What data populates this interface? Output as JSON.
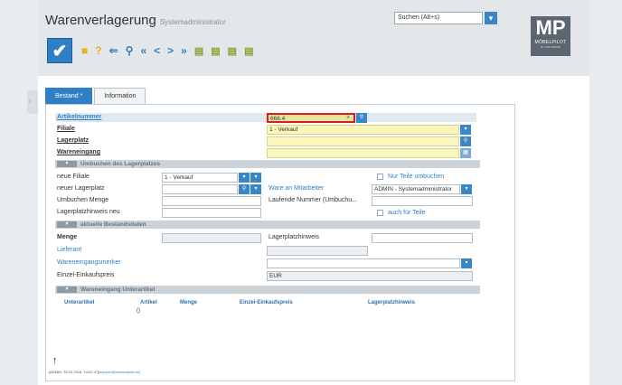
{
  "header": {
    "title": "Warenverlagerung",
    "subtitle": "Systemadministrator",
    "search_placeholder": "Suchen (Alt+s)"
  },
  "logo": {
    "mp": "MP",
    "brand": "MÖBELPILOT",
    "tagline": "BY SOFTWARE"
  },
  "toolbar": {
    "icons": [
      "check-icon",
      "save-icon",
      "help-icon",
      "back-icon",
      "search-icon",
      "first-icon",
      "prev-icon",
      "next-icon",
      "last-icon",
      "db-icon",
      "db-add-icon",
      "db-edit-icon",
      "db-delete-icon"
    ],
    "glyphs": {
      "check": "✔",
      "help": "?",
      "back": "⇐",
      "search": "🔍",
      "first": "«",
      "prev": "<",
      "next": ">",
      "last": "»"
    }
  },
  "tabs": [
    {
      "label": "Bestand *",
      "active": true
    },
    {
      "label": "Information",
      "active": false
    }
  ],
  "form": {
    "artikelnummer_label": "Artikelnummer",
    "artikelnummer_value": "666.4",
    "filiale_label": "Filiale",
    "filiale_value": "1 - Verkauf",
    "lagerplatz_label": "Lagerplatz",
    "wareneingang_label": "Wareneingang"
  },
  "umbuchen": {
    "section_title": "Umbuchen des Lagerplatzes",
    "neue_filiale_label": "neue Filiale",
    "neue_filiale_value": "1 - Verkauf",
    "neuer_lagerplatz_label": "neuer Lagerplatz",
    "umbuchen_menge_label": "Umbuchen Menge",
    "lagerplatzhinweis_neu_label": "Lagerplatzhinweis neu",
    "nur_teile_label": "Nur Teile umbuchen",
    "ware_an_mitarbeiter_label": "Ware an Mitarbeiter",
    "mitarbeiter_value": "ADMIN - Systemadministrator",
    "laufende_nummer_label": "Laufende Nummer (Umbuchu...",
    "auch_fuer_teile_label": "auch für Teile"
  },
  "bestandsdaten": {
    "section_title": "aktuelle Bestandsdaten",
    "menge_label": "Menge",
    "lieferant_label": "Lieferant",
    "wareneingangsmerker_label": "Wareneingangsmerker",
    "einzel_einkaufspreis_label": "Einzel-Einkaufspreis",
    "lagerplatzhinweis_label": "Lagerplatzhinweis",
    "currency": "EUR"
  },
  "unterartikel": {
    "section_title": "Wareneingang Unterartikel",
    "columns": [
      "Unterartikel",
      "Artikel",
      "Menge",
      "Einzel-Einkaufspreis",
      "Lagerplatzhinweis"
    ],
    "row": [
      "",
      "()",
      "",
      "",
      ""
    ]
  },
  "footer": {
    "arrow": "↑",
    "info": "[ADMIN, 30.03.2016, 14:02:47]",
    "email": "[support@moebelpilot.de]"
  },
  "colors": {
    "accent": "#2f7fc6",
    "required": "#fbf7bb",
    "error": "#d81e1e"
  }
}
